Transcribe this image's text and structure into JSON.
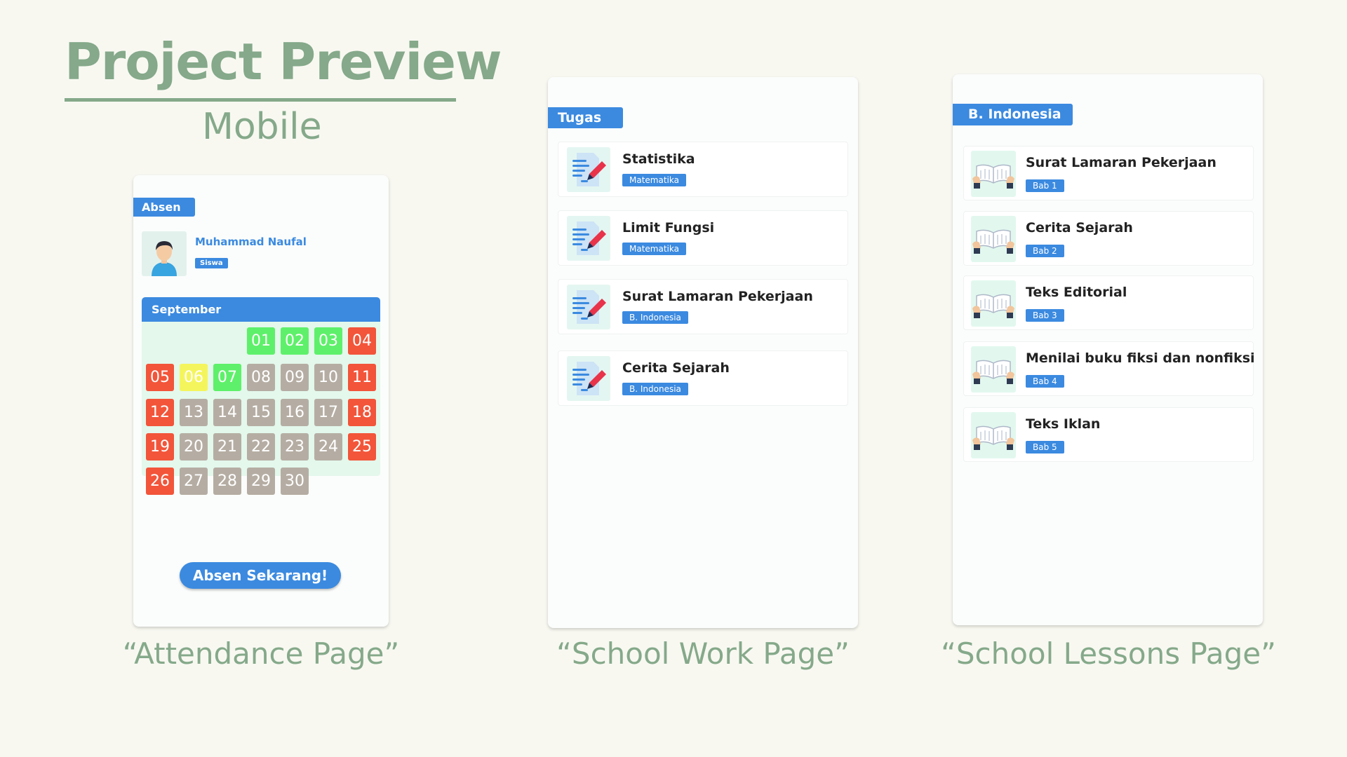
{
  "header": {
    "title": "Project Preview",
    "subtitle": "Mobile"
  },
  "captions": {
    "attendance": "“Attendance Page”",
    "schoolwork": "“School Work Page”",
    "lessons": "“School Lessons Page”"
  },
  "attendance": {
    "tag": "Absen",
    "user": {
      "name": "Muhammad Naufal",
      "role": "Siswa"
    },
    "month": "September",
    "days": [
      {
        "label": "01",
        "status": "green"
      },
      {
        "label": "02",
        "status": "green"
      },
      {
        "label": "03",
        "status": "green"
      },
      {
        "label": "04",
        "status": "red"
      },
      {
        "label": "05",
        "status": "red"
      },
      {
        "label": "06",
        "status": "yellow"
      },
      {
        "label": "07",
        "status": "green"
      },
      {
        "label": "08",
        "status": "gray"
      },
      {
        "label": "09",
        "status": "gray"
      },
      {
        "label": "10",
        "status": "gray"
      },
      {
        "label": "11",
        "status": "red"
      },
      {
        "label": "12",
        "status": "red"
      },
      {
        "label": "13",
        "status": "gray"
      },
      {
        "label": "14",
        "status": "gray"
      },
      {
        "label": "15",
        "status": "gray"
      },
      {
        "label": "16",
        "status": "gray"
      },
      {
        "label": "17",
        "status": "gray"
      },
      {
        "label": "18",
        "status": "red"
      },
      {
        "label": "19",
        "status": "red"
      },
      {
        "label": "20",
        "status": "gray"
      },
      {
        "label": "21",
        "status": "gray"
      },
      {
        "label": "22",
        "status": "gray"
      },
      {
        "label": "23",
        "status": "gray"
      },
      {
        "label": "24",
        "status": "gray"
      },
      {
        "label": "25",
        "status": "red"
      },
      {
        "label": "26",
        "status": "red"
      },
      {
        "label": "27",
        "status": "gray"
      },
      {
        "label": "28",
        "status": "gray"
      },
      {
        "label": "29",
        "status": "gray"
      },
      {
        "label": "30",
        "status": "gray"
      }
    ],
    "colors": {
      "green": "#5ef06a",
      "red": "#f2553a",
      "yellow": "#f4f55c",
      "gray": "#b5ada3"
    },
    "button": "Absen Sekarang!"
  },
  "schoolwork": {
    "tag": "Tugas",
    "items": [
      {
        "title": "Statistika",
        "subject": "Matematika",
        "icon": "document-edit-icon"
      },
      {
        "title": "Limit Fungsi",
        "subject": "Matematika",
        "icon": "document-edit-icon"
      },
      {
        "title": "Surat Lamaran Pekerjaan",
        "subject": "B. Indonesia",
        "icon": "document-edit-icon"
      },
      {
        "title": "Cerita Sejarah",
        "subject": "B. Indonesia",
        "icon": "document-edit-icon"
      }
    ]
  },
  "lessons": {
    "tag": "B. Indonesia",
    "items": [
      {
        "title": "Surat Lamaran Pekerjaan",
        "chapter": "Bab 1",
        "icon": "open-book-icon"
      },
      {
        "title": "Cerita Sejarah",
        "chapter": "Bab 2",
        "icon": "open-book-icon"
      },
      {
        "title": "Teks Editorial",
        "chapter": "Bab 3",
        "icon": "open-book-icon"
      },
      {
        "title": "Menilai buku fiksi dan nonfiksi",
        "chapter": "Bab 4",
        "icon": "open-book-icon"
      },
      {
        "title": "Teks Iklan",
        "chapter": "Bab 5",
        "icon": "open-book-icon"
      }
    ]
  }
}
